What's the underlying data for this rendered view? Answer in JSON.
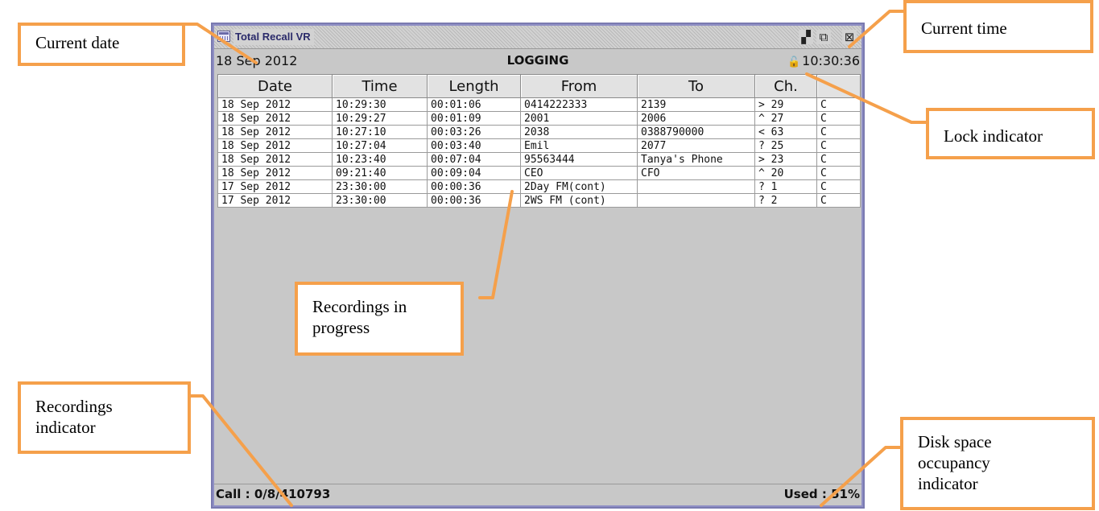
{
  "window": {
    "title": "Total Recall VR",
    "buttons": {
      "minimize": "▞",
      "maximize": "⧉",
      "close": "⊠"
    }
  },
  "infobar": {
    "date": "18 Sep 2012",
    "mode": "LOGGING",
    "time": "10:30:36",
    "lock_glyph": "🔓"
  },
  "table": {
    "columns": [
      "Date",
      "Time",
      "Length",
      "From",
      "To",
      "Ch.",
      ""
    ],
    "rows": [
      [
        "18 Sep 2012",
        "10:29:30",
        "00:01:06",
        "0414222333",
        "2139",
        "> 29",
        "C"
      ],
      [
        "18 Sep 2012",
        "10:29:27",
        "00:01:09",
        "2001",
        "2006",
        "^ 27",
        "C"
      ],
      [
        "18 Sep 2012",
        "10:27:10",
        "00:03:26",
        "2038",
        "0388790000",
        "< 63",
        "C"
      ],
      [
        "18 Sep 2012",
        "10:27:04",
        "00:03:40",
        "Emil",
        "2077",
        "? 25",
        "C"
      ],
      [
        "18 Sep 2012",
        "10:23:40",
        "00:07:04",
        "95563444",
        "Tanya's Phone",
        "> 23",
        "C"
      ],
      [
        "18 Sep 2012",
        "09:21:40",
        "00:09:04",
        "CEO",
        "CFO",
        "^ 20",
        "C"
      ],
      [
        "17 Sep 2012",
        "23:30:00",
        "00:00:36",
        "2Day FM(cont)",
        "",
        "? 1",
        "C"
      ],
      [
        "17 Sep 2012",
        "23:30:00",
        "00:00:36",
        "2WS FM (cont)",
        "",
        "? 2",
        "C"
      ]
    ]
  },
  "statusbar": {
    "calls": "Call : 0/8/410793",
    "disk": "Used : 51%"
  },
  "callouts": {
    "current_date": "Current date",
    "current_time": "Current time",
    "lock_indicator": "Lock indicator",
    "recordings_in_progress": "Recordings in progress",
    "recordings_indicator": "Recordings indicator",
    "disk_space": "Disk space occupancy indicator"
  },
  "colors": {
    "accent": "#f5a04b",
    "window_bg": "#c8c8c8",
    "border": "#7a7ab0"
  }
}
